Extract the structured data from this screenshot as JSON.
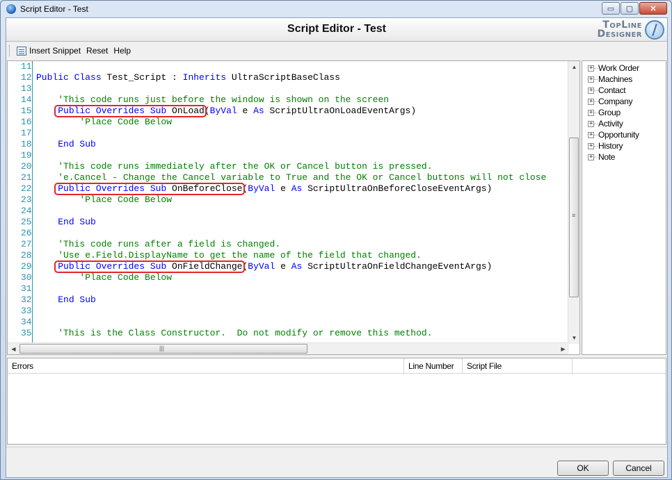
{
  "window": {
    "title": "Script Editor - Test",
    "controls": {
      "minimize": "▭",
      "maximize": "▢",
      "close": "✕"
    }
  },
  "header": {
    "title": "Script Editor - Test",
    "logo_line1": "TopLine",
    "logo_line2": "Designer"
  },
  "toolbar": {
    "insert_snippet": "Insert Snippet",
    "reset": "Reset",
    "help": "Help"
  },
  "editor": {
    "lines": [
      {
        "n": "11",
        "segs": []
      },
      {
        "n": "12",
        "segs": [
          {
            "t": "Public Class",
            "c": "kw"
          },
          {
            "t": " Test_Script : ",
            "c": "tx"
          },
          {
            "t": "Inherits",
            "c": "kw"
          },
          {
            "t": " UltraScriptBaseClass",
            "c": "tx"
          }
        ]
      },
      {
        "n": "13",
        "segs": []
      },
      {
        "n": "14",
        "segs": [
          {
            "t": "    'This code runs just before the window is shown on the screen",
            "c": "cm"
          }
        ]
      },
      {
        "n": "15",
        "segs": [
          {
            "t": "    ",
            "c": "tx"
          },
          {
            "t": "Public Overrides Sub",
            "c": "kw"
          },
          {
            "t": " OnLoad",
            "c": "tx"
          },
          {
            "t": "(",
            "c": "tx"
          },
          {
            "t": "ByVal",
            "c": "kw"
          },
          {
            "t": " e ",
            "c": "tx"
          },
          {
            "t": "As",
            "c": "kw"
          },
          {
            "t": " ScriptUltraOnLoadEventArgs)",
            "c": "tx"
          }
        ]
      },
      {
        "n": "16",
        "segs": [
          {
            "t": "        'Place Code Below",
            "c": "cm"
          }
        ]
      },
      {
        "n": "17",
        "segs": []
      },
      {
        "n": "18",
        "segs": [
          {
            "t": "    ",
            "c": "tx"
          },
          {
            "t": "End Sub",
            "c": "kw"
          }
        ]
      },
      {
        "n": "19",
        "segs": []
      },
      {
        "n": "20",
        "segs": [
          {
            "t": "    'This code runs immediately after the OK or Cancel button is pressed.",
            "c": "cm"
          }
        ]
      },
      {
        "n": "21",
        "segs": [
          {
            "t": "    'e.Cancel - Change the Cancel variable to True and the OK or Cancel buttons will not close",
            "c": "cm"
          }
        ]
      },
      {
        "n": "22",
        "segs": [
          {
            "t": "    ",
            "c": "tx"
          },
          {
            "t": "Public Overrides Sub",
            "c": "kw"
          },
          {
            "t": " OnBeforeClose",
            "c": "tx"
          },
          {
            "t": "(",
            "c": "tx"
          },
          {
            "t": "ByVal",
            "c": "kw"
          },
          {
            "t": " e ",
            "c": "tx"
          },
          {
            "t": "As",
            "c": "kw"
          },
          {
            "t": " ScriptUltraOnBeforeCloseEventArgs)",
            "c": "tx"
          }
        ]
      },
      {
        "n": "23",
        "segs": [
          {
            "t": "        'Place Code Below",
            "c": "cm"
          }
        ]
      },
      {
        "n": "24",
        "segs": []
      },
      {
        "n": "25",
        "segs": [
          {
            "t": "    ",
            "c": "tx"
          },
          {
            "t": "End Sub",
            "c": "kw"
          }
        ]
      },
      {
        "n": "26",
        "segs": []
      },
      {
        "n": "27",
        "segs": [
          {
            "t": "    'This code runs after a field is changed.",
            "c": "cm"
          }
        ]
      },
      {
        "n": "28",
        "segs": [
          {
            "t": "    'Use e.Field.DisplayName to get the name of the field that changed.",
            "c": "cm"
          }
        ]
      },
      {
        "n": "29",
        "segs": [
          {
            "t": "    ",
            "c": "tx"
          },
          {
            "t": "Public Overrides Sub",
            "c": "kw"
          },
          {
            "t": " OnFieldChange",
            "c": "tx"
          },
          {
            "t": "(",
            "c": "tx"
          },
          {
            "t": "ByVal",
            "c": "kw"
          },
          {
            "t": " e ",
            "c": "tx"
          },
          {
            "t": "As",
            "c": "kw"
          },
          {
            "t": " ScriptUltraOnFieldChangeEventArgs)",
            "c": "tx"
          }
        ]
      },
      {
        "n": "30",
        "segs": [
          {
            "t": "        'Place Code Below",
            "c": "cm"
          }
        ]
      },
      {
        "n": "31",
        "segs": []
      },
      {
        "n": "32",
        "segs": [
          {
            "t": "    ",
            "c": "tx"
          },
          {
            "t": "End Sub",
            "c": "kw"
          }
        ]
      },
      {
        "n": "33",
        "segs": []
      },
      {
        "n": "34",
        "segs": []
      },
      {
        "n": "35",
        "segs": [
          {
            "t": "    'This is the Class Constructor.  Do not modify or remove this method.",
            "c": "cm"
          }
        ]
      }
    ],
    "highlights": [
      {
        "line": "15",
        "text": "Public Overrides Sub OnLoad"
      },
      {
        "line": "22",
        "text": "Public Overrides Sub OnBeforeClose"
      },
      {
        "line": "29",
        "text": "Public Overrides Sub OnFieldChange"
      }
    ]
  },
  "tree": {
    "items": [
      "Work Order",
      "Machines",
      "Contact",
      "Company",
      "Group",
      "Activity",
      "Opportunity",
      "History",
      "Note"
    ]
  },
  "errors": {
    "columns": [
      "Errors",
      "Line Number",
      "Script File"
    ]
  },
  "buttons": {
    "ok": "OK",
    "cancel": "Cancel"
  },
  "colors": {
    "keyword": "#0000ff",
    "comment": "#008000",
    "line_number": "#2b91af",
    "highlight_box": "#e0262a"
  }
}
